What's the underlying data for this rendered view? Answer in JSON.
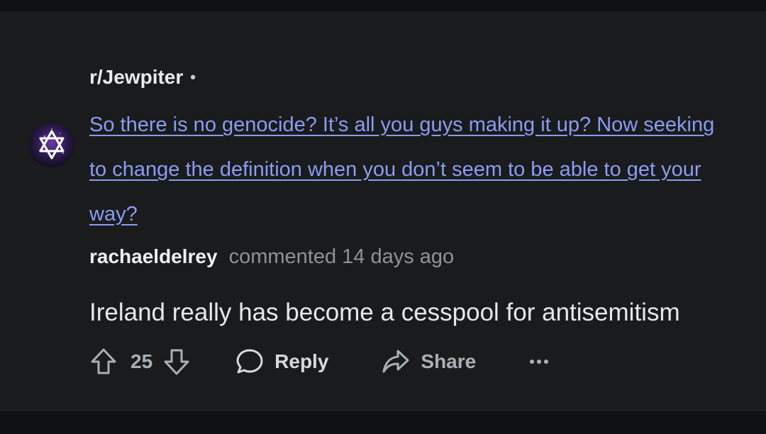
{
  "post": {
    "subreddit": "r/Jewpiter",
    "separator": "•",
    "title": "So there is no genocide? It’s all you guys making it up? Now seeking to change the definition when you don’t seem to be able to get your way?",
    "avatar_icon": "star-of-david-icon"
  },
  "comment": {
    "author": "rachaeldelrey",
    "meta": "commented 14 days ago",
    "body": "Ireland really has become a cesspool for antisemitism"
  },
  "actions": {
    "upvote_icon": "upvote-arrow-icon",
    "vote_count": "25",
    "downvote_icon": "downvote-arrow-icon",
    "reply_icon": "speech-bubble-icon",
    "reply_label": "Reply",
    "share_icon": "share-arrow-icon",
    "share_label": "Share",
    "more_icon": "ellipsis-icon"
  },
  "colors": {
    "background": "#1a1b1c",
    "link": "#8b9cf5",
    "meta": "#8c9499",
    "action": "#a9b0b5"
  }
}
